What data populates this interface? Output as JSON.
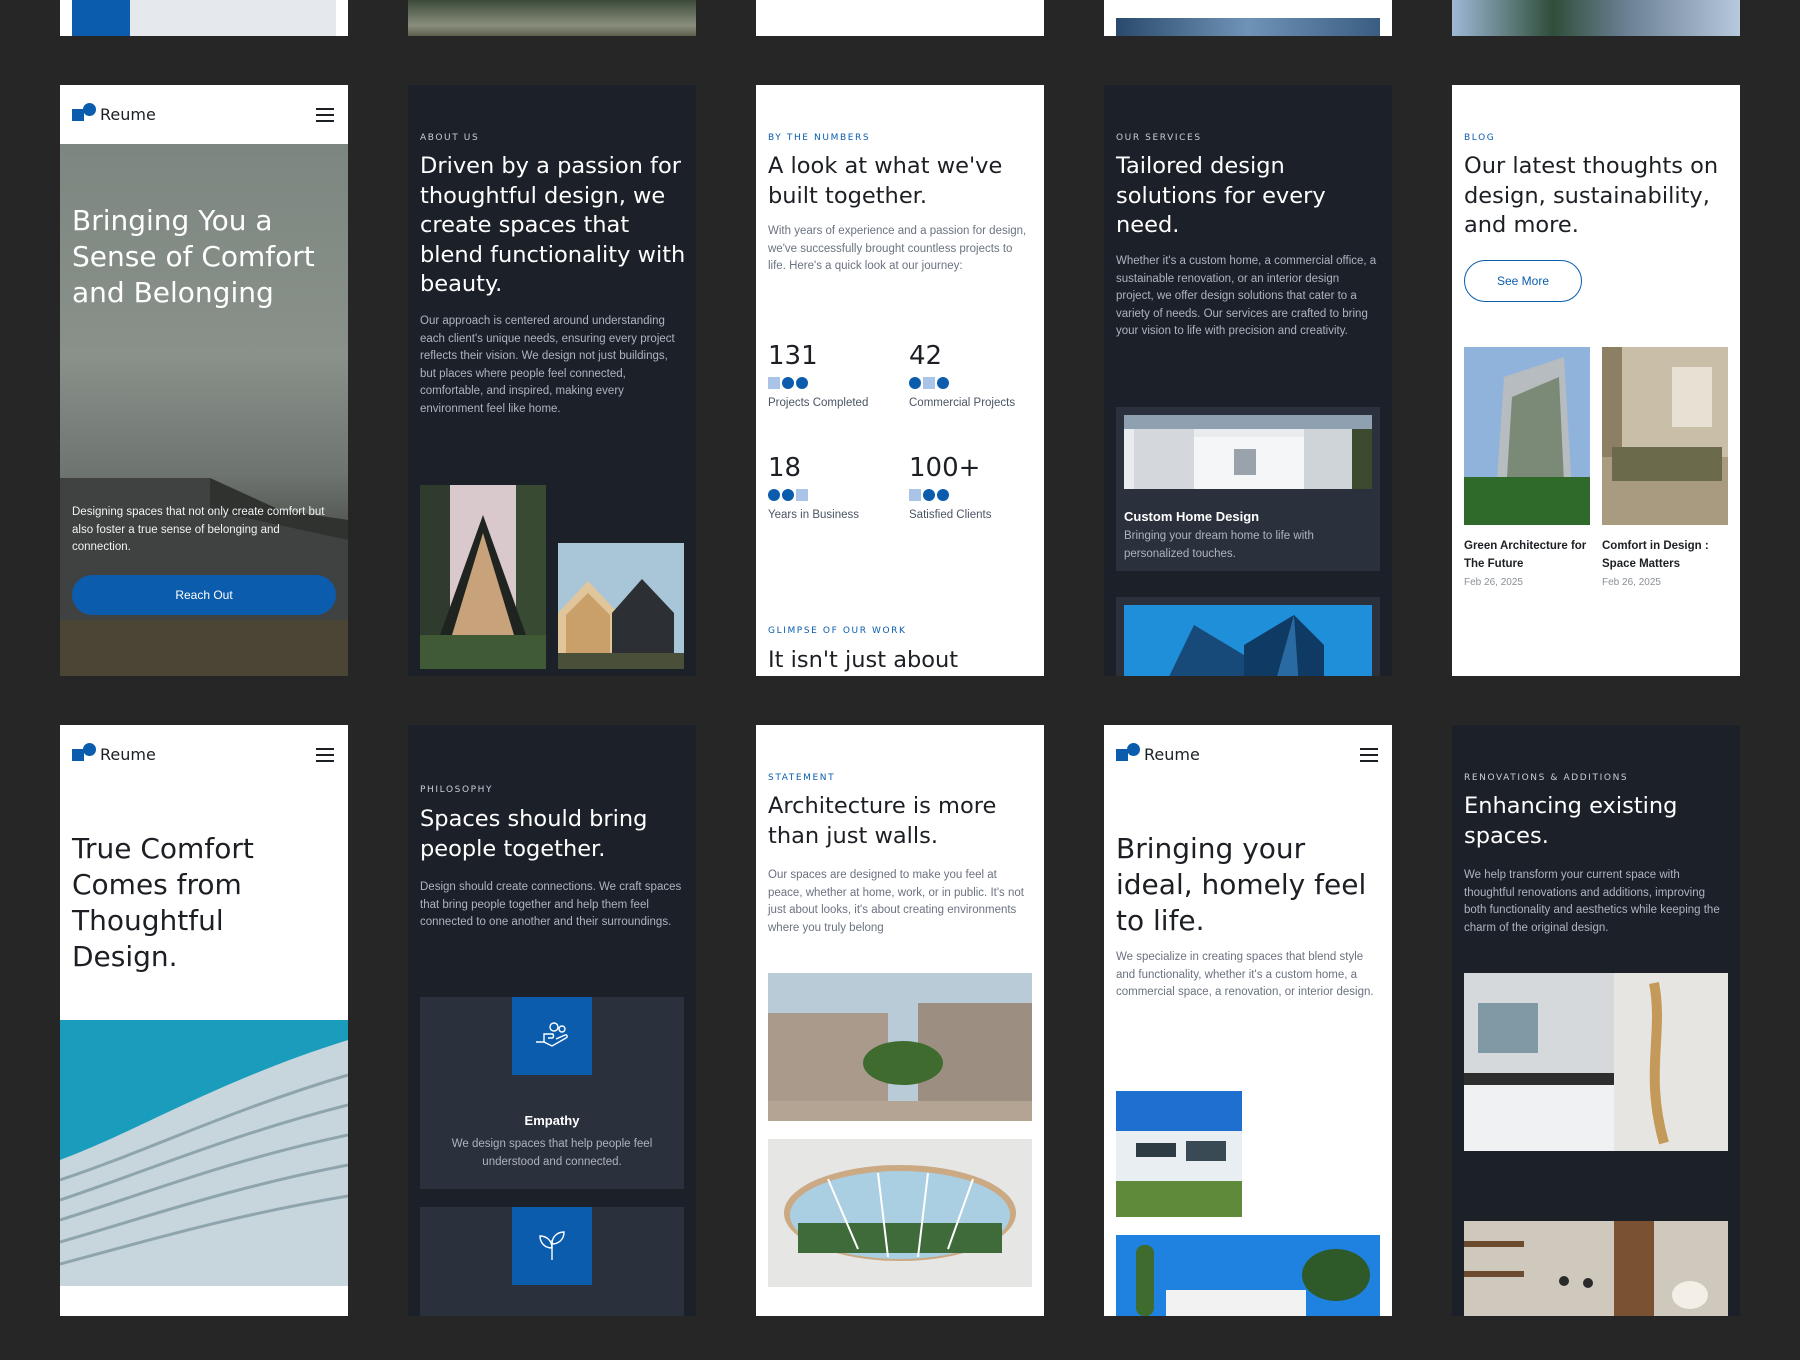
{
  "brand": {
    "name": "Reume"
  },
  "hero": {
    "title": "Bringing You a Sense of Comfort and Belonging",
    "body": "Designing spaces that not only create comfort but also foster a true sense of belonging and connection.",
    "cta": "Reach Out"
  },
  "about": {
    "eyebrow": "About Us",
    "title": "Driven by a passion for thoughtful design, we create spaces that blend functionality with beauty.",
    "body": "Our approach is centered around understanding each client's unique needs, ensuring every project reflects their vision. We design not just buildings, but places where people feel connected, comfortable, and inspired, making every environment feel like home."
  },
  "numbers": {
    "eyebrow": "By the Numbers",
    "title": "A look at what we've built together.",
    "body": "With years of experience and a passion for design, we've successfully brought countless projects to life. Here's a quick look at our journey:",
    "stats": [
      {
        "value": "131",
        "label": "Projects Completed"
      },
      {
        "value": "42",
        "label": "Commercial Projects"
      },
      {
        "value": "18",
        "label": "Years in Business"
      },
      {
        "value": "100+",
        "label": "Satisfied Clients"
      }
    ],
    "work_eyebrow": "Glimpse of Our Work",
    "work_title": "It isn't just about"
  },
  "services": {
    "eyebrow": "Our Services",
    "title": "Tailored design solutions for every need.",
    "body": "Whether it's a custom home, a commercial office, a sustainable renovation, or an interior design project, we offer design solutions that cater to a variety of needs. Our services are crafted to bring your vision to life with precision and creativity.",
    "card_title": "Custom Home Design",
    "card_body": "Bringing your dream home to life with personalized touches."
  },
  "blog": {
    "eyebrow": "Blog",
    "title": "Our latest thoughts on design, sustainability, and more.",
    "button": "See More",
    "posts": [
      {
        "title": "Green Architecture for The Future",
        "date": "Feb 26, 2025"
      },
      {
        "title": "Comfort in Design : Space Matters",
        "date": "Feb 26, 2025"
      }
    ]
  },
  "comfort": {
    "title": "True Comfort Comes from Thoughtful Design."
  },
  "philosophy": {
    "eyebrow": "Philosophy",
    "title": "Spaces should bring people together.",
    "body": "Design should create connections. We craft spaces that bring people together and help them feel connected to one another and their surroundings.",
    "card_title": "Empathy",
    "card_body": "We design spaces that help people feel understood and connected."
  },
  "statement": {
    "eyebrow": "Statement",
    "title": "Architecture is more than just walls.",
    "body": "Our spaces are designed to make you feel at peace, whether at home, work, or in public. It's not just about looks, it's about creating environments where you truly belong"
  },
  "homely": {
    "title": "Bringing your ideal, homely feel to life.",
    "body": "We specialize in creating spaces that blend style and functionality, whether it's a custom home, a commercial space, a renovation, or interior design."
  },
  "renovations": {
    "eyebrow": "Renovations & Additions",
    "title": "Enhancing existing spaces.",
    "body": "We help transform your current space with thoughtful renovations and additions, improving both functionality and aesthetics while keeping the charm of the original design."
  },
  "colors": {
    "accent": "#0b5cad",
    "dark": "#1c2029",
    "page": "#262626"
  }
}
